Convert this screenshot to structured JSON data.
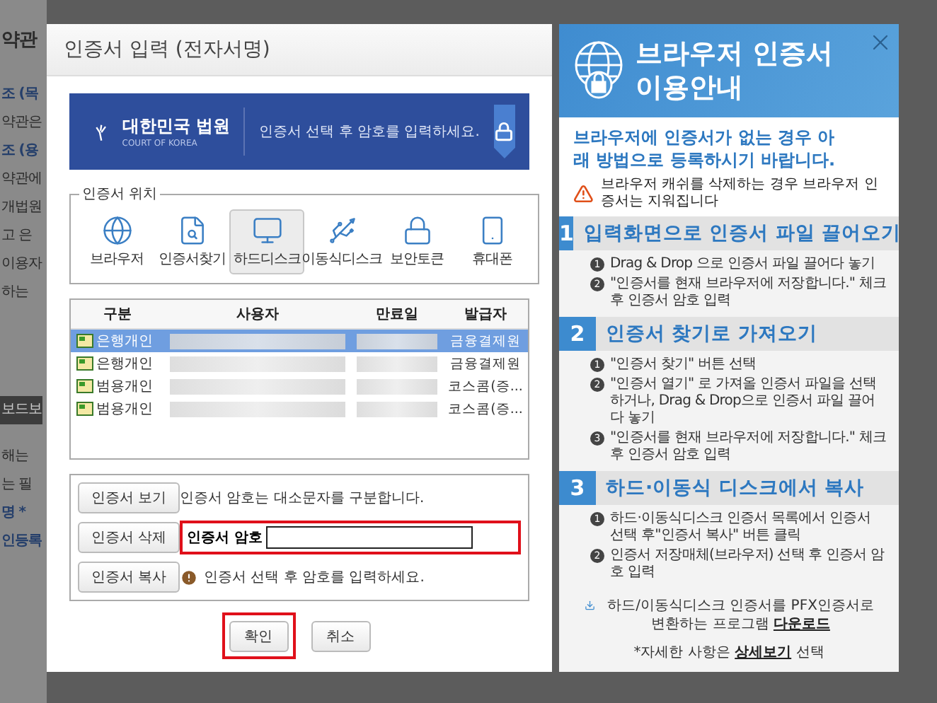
{
  "background_page": {
    "lines": [
      {
        "text": "약관",
        "kind": "heading"
      },
      {
        "text": "조 (목",
        "kind": "link"
      },
      {
        "text": "약관은",
        "kind": "body"
      },
      {
        "text": "조 (용",
        "kind": "link"
      },
      {
        "text": "약관에",
        "kind": "body"
      },
      {
        "text": "개법원",
        "kind": "body"
      },
      {
        "text": "고 은",
        "kind": "body"
      },
      {
        "text": "이용자",
        "kind": "body"
      },
      {
        "text": "하는",
        "kind": "body"
      },
      {
        "text": "보드보",
        "kind": "band"
      },
      {
        "text": "해는",
        "kind": "body"
      },
      {
        "text": "는 필",
        "kind": "body"
      },
      {
        "text": "명 *",
        "kind": "link"
      },
      {
        "text": "인등록",
        "kind": "link"
      }
    ]
  },
  "dialog": {
    "title": "인증서 입력 (전자서명)",
    "banner": {
      "logo_text": "대한민국 법원",
      "logo_sub": "COURT OF KOREA",
      "message": "인증서 선택 후 암호를 입력하세요."
    },
    "location": {
      "legend": "인증서 위치",
      "items": [
        {
          "label": "브라우저",
          "kind": "globe",
          "selected": false
        },
        {
          "label": "인증서찾기",
          "kind": "search",
          "selected": false
        },
        {
          "label": "하드디스크",
          "kind": "monitor",
          "selected": true
        },
        {
          "label": "이동식디스크",
          "kind": "usb",
          "selected": false
        },
        {
          "label": "보안토큰",
          "kind": "token",
          "selected": false
        },
        {
          "label": "휴대폰",
          "kind": "phone",
          "selected": false
        }
      ]
    },
    "table": {
      "columns": [
        "구분",
        "사용자",
        "만료일",
        "발급자"
      ],
      "rows": [
        {
          "type": "은행개인",
          "issuer": "금융결제원",
          "selected": true
        },
        {
          "type": "은행개인",
          "issuer": "금융결제원",
          "selected": false
        },
        {
          "type": "범용개인",
          "issuer": "코스콤(증...",
          "selected": false
        },
        {
          "type": "범용개인",
          "issuer": "코스콤(증...",
          "selected": false
        }
      ]
    },
    "actions": [
      "인증서 보기",
      "인증서 삭제",
      "인증서 복사"
    ],
    "case_note": "인증서 암호는 대소문자를 구분합니다.",
    "password": {
      "label": "인증서 암호",
      "highlighted": true
    },
    "hint": "인증서 선택 후 암호를 입력하세요.",
    "buttons": [
      {
        "label": "확인",
        "highlighted": true
      },
      {
        "label": "취소",
        "highlighted": false
      }
    ]
  },
  "guide": {
    "title_lines": [
      "브라우저 인증서",
      "이용안내"
    ],
    "subtitle": "브라우저에 인증서가 없는 경우 아래 방법으로 등록하시기 바랍니다.",
    "warning": "브라우저 캐쉬를 삭제하는 경우 브라우저 인증서는 지워집니다",
    "sections": [
      {
        "number": "1",
        "title": "입력화면으로 인증서 파일 끌어오기",
        "steps": [
          {
            "number": "1",
            "text": "Drag & Drop 으로 인증서 파일 끌어다 놓기"
          },
          {
            "number": "2",
            "text": "\"인증서를 현재 브라우저에 저장합니다.\" 체크 후 인증서 암호 입력"
          }
        ]
      },
      {
        "number": "2",
        "title": "인증서 찾기로 가져오기",
        "steps": [
          {
            "number": "1",
            "text": "\"인증서 찾기\" 버튼 선택"
          },
          {
            "number": "2",
            "text": "\"인증서 열기\" 로 가져올 인증서 파일을 선택 하거나, Drag & Drop으로 인증서 파일 끌어다 놓기"
          },
          {
            "number": "3",
            "text": "\"인증서를 현재 브라우저에 저장합니다.\" 체크 후 인증서 암호 입력"
          }
        ]
      },
      {
        "number": "3",
        "title": "하드·이동식 디스크에서 복사",
        "steps": [
          {
            "number": "1",
            "text": "하드·이동식디스크 인증서 목록에서 인증서 선택 후\"인증서 복사\" 버튼 클릭"
          },
          {
            "number": "2",
            "text": "인증서 저장매체(브라우저) 선택 후 인증서 암호 입력"
          }
        ]
      }
    ],
    "download": {
      "text": "하드/이동식디스크 인증서를 PFX인증서로 변환하는 프로그램",
      "link": "다운로드"
    },
    "detail": {
      "before": "*자세한 사항은",
      "link": "상세보기",
      "after": "선택"
    }
  }
}
